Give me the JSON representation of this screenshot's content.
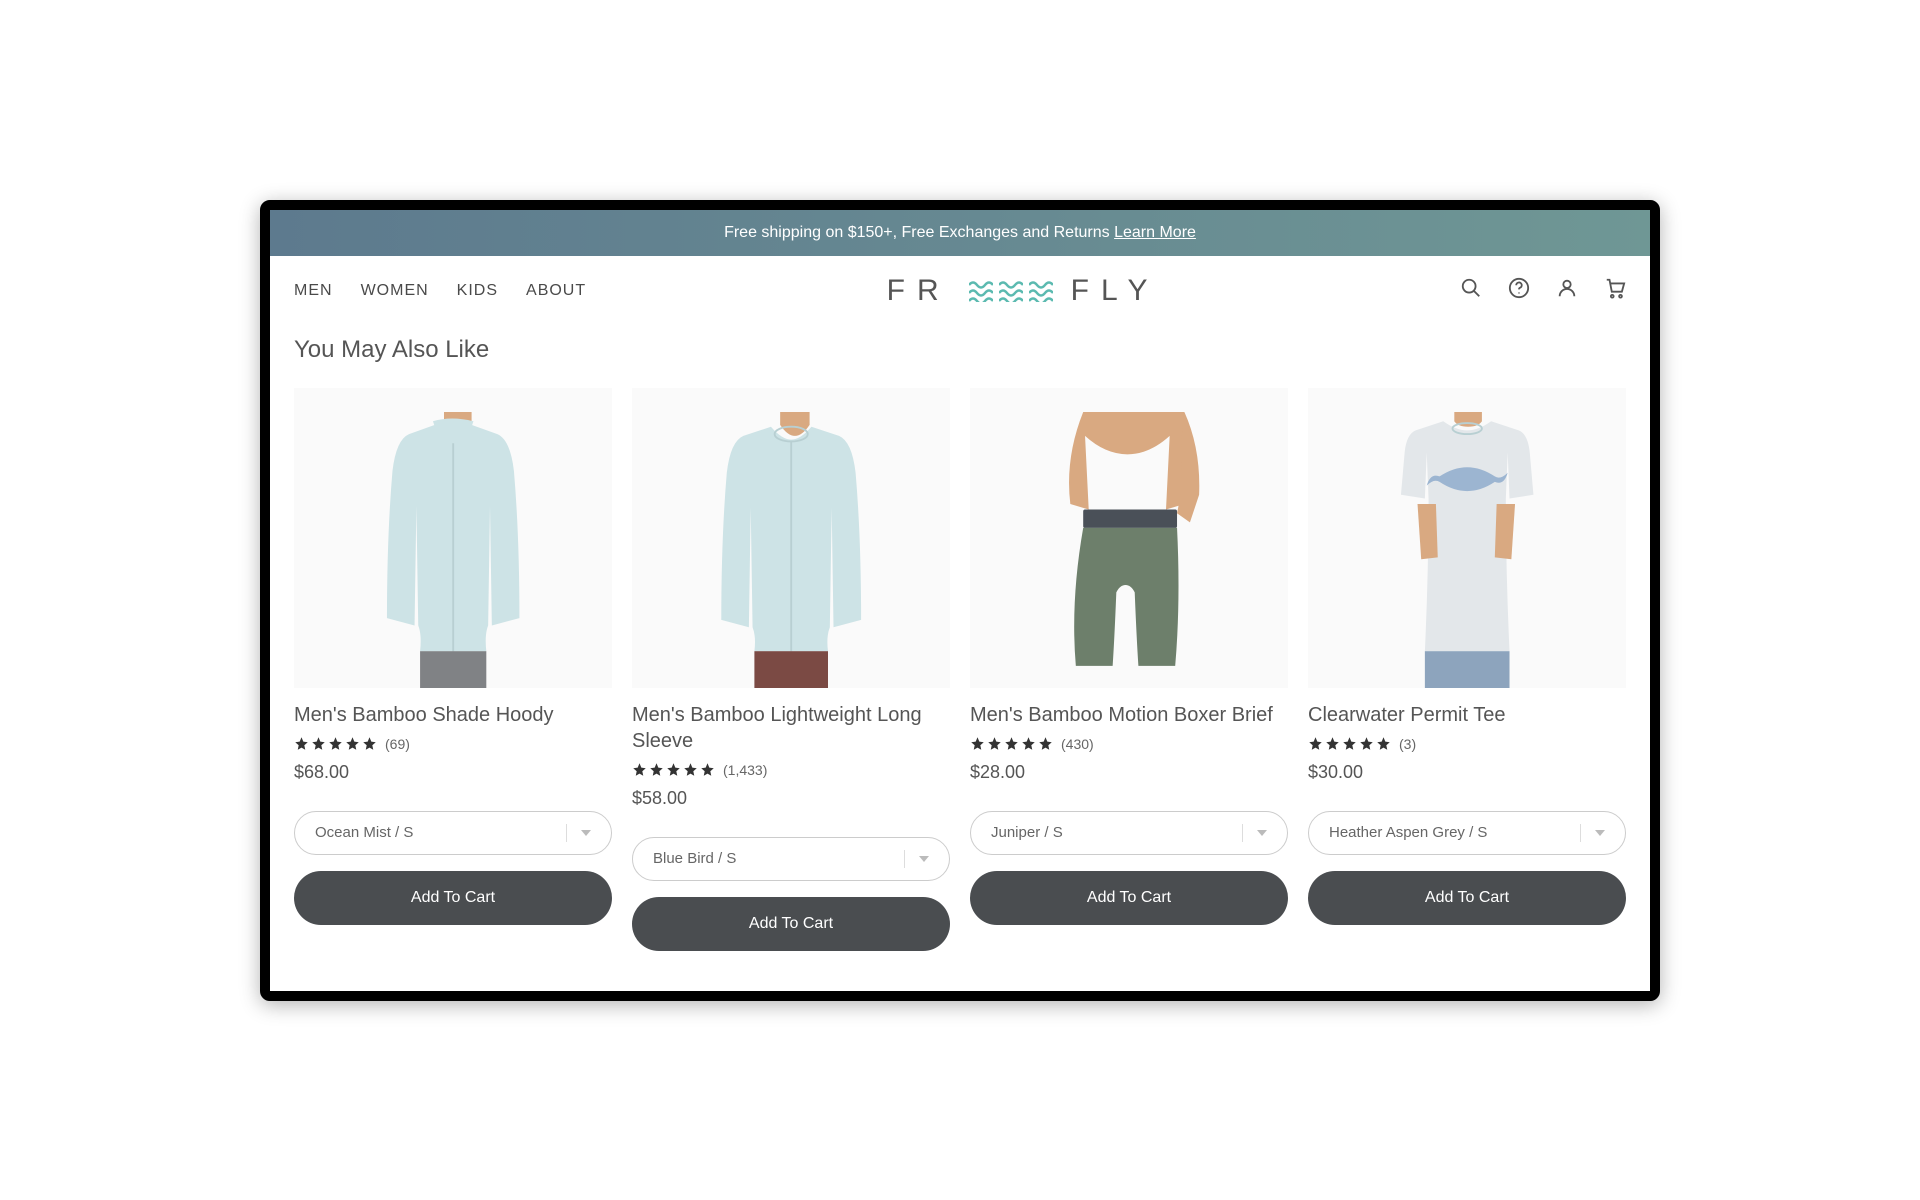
{
  "promo": {
    "text": "Free shipping on $150+, Free Exchanges and Returns ",
    "link": "Learn More"
  },
  "nav": {
    "items": [
      "MEN",
      "WOMEN",
      "KIDS",
      "ABOUT"
    ]
  },
  "logo": {
    "left": "FR",
    "right": "FLY"
  },
  "section": {
    "title": "You May Also Like"
  },
  "products": [
    {
      "title": "Men's Bamboo Shade Hoody",
      "reviews": "(69)",
      "price": "$68.00",
      "variant": "Ocean Mist / S",
      "cta": "Add To Cart"
    },
    {
      "title": "Men's Bamboo Lightweight Long Sleeve",
      "reviews": "(1,433)",
      "price": "$58.00",
      "variant": "Blue Bird / S",
      "cta": "Add To Cart"
    },
    {
      "title": "Men's Bamboo Motion Boxer Brief",
      "reviews": "(430)",
      "price": "$28.00",
      "variant": "Juniper / S",
      "cta": "Add To Cart"
    },
    {
      "title": "Clearwater Permit Tee",
      "reviews": "(3)",
      "price": "$30.00",
      "variant": "Heather Aspen Grey / S",
      "cta": "Add To Cart"
    }
  ]
}
